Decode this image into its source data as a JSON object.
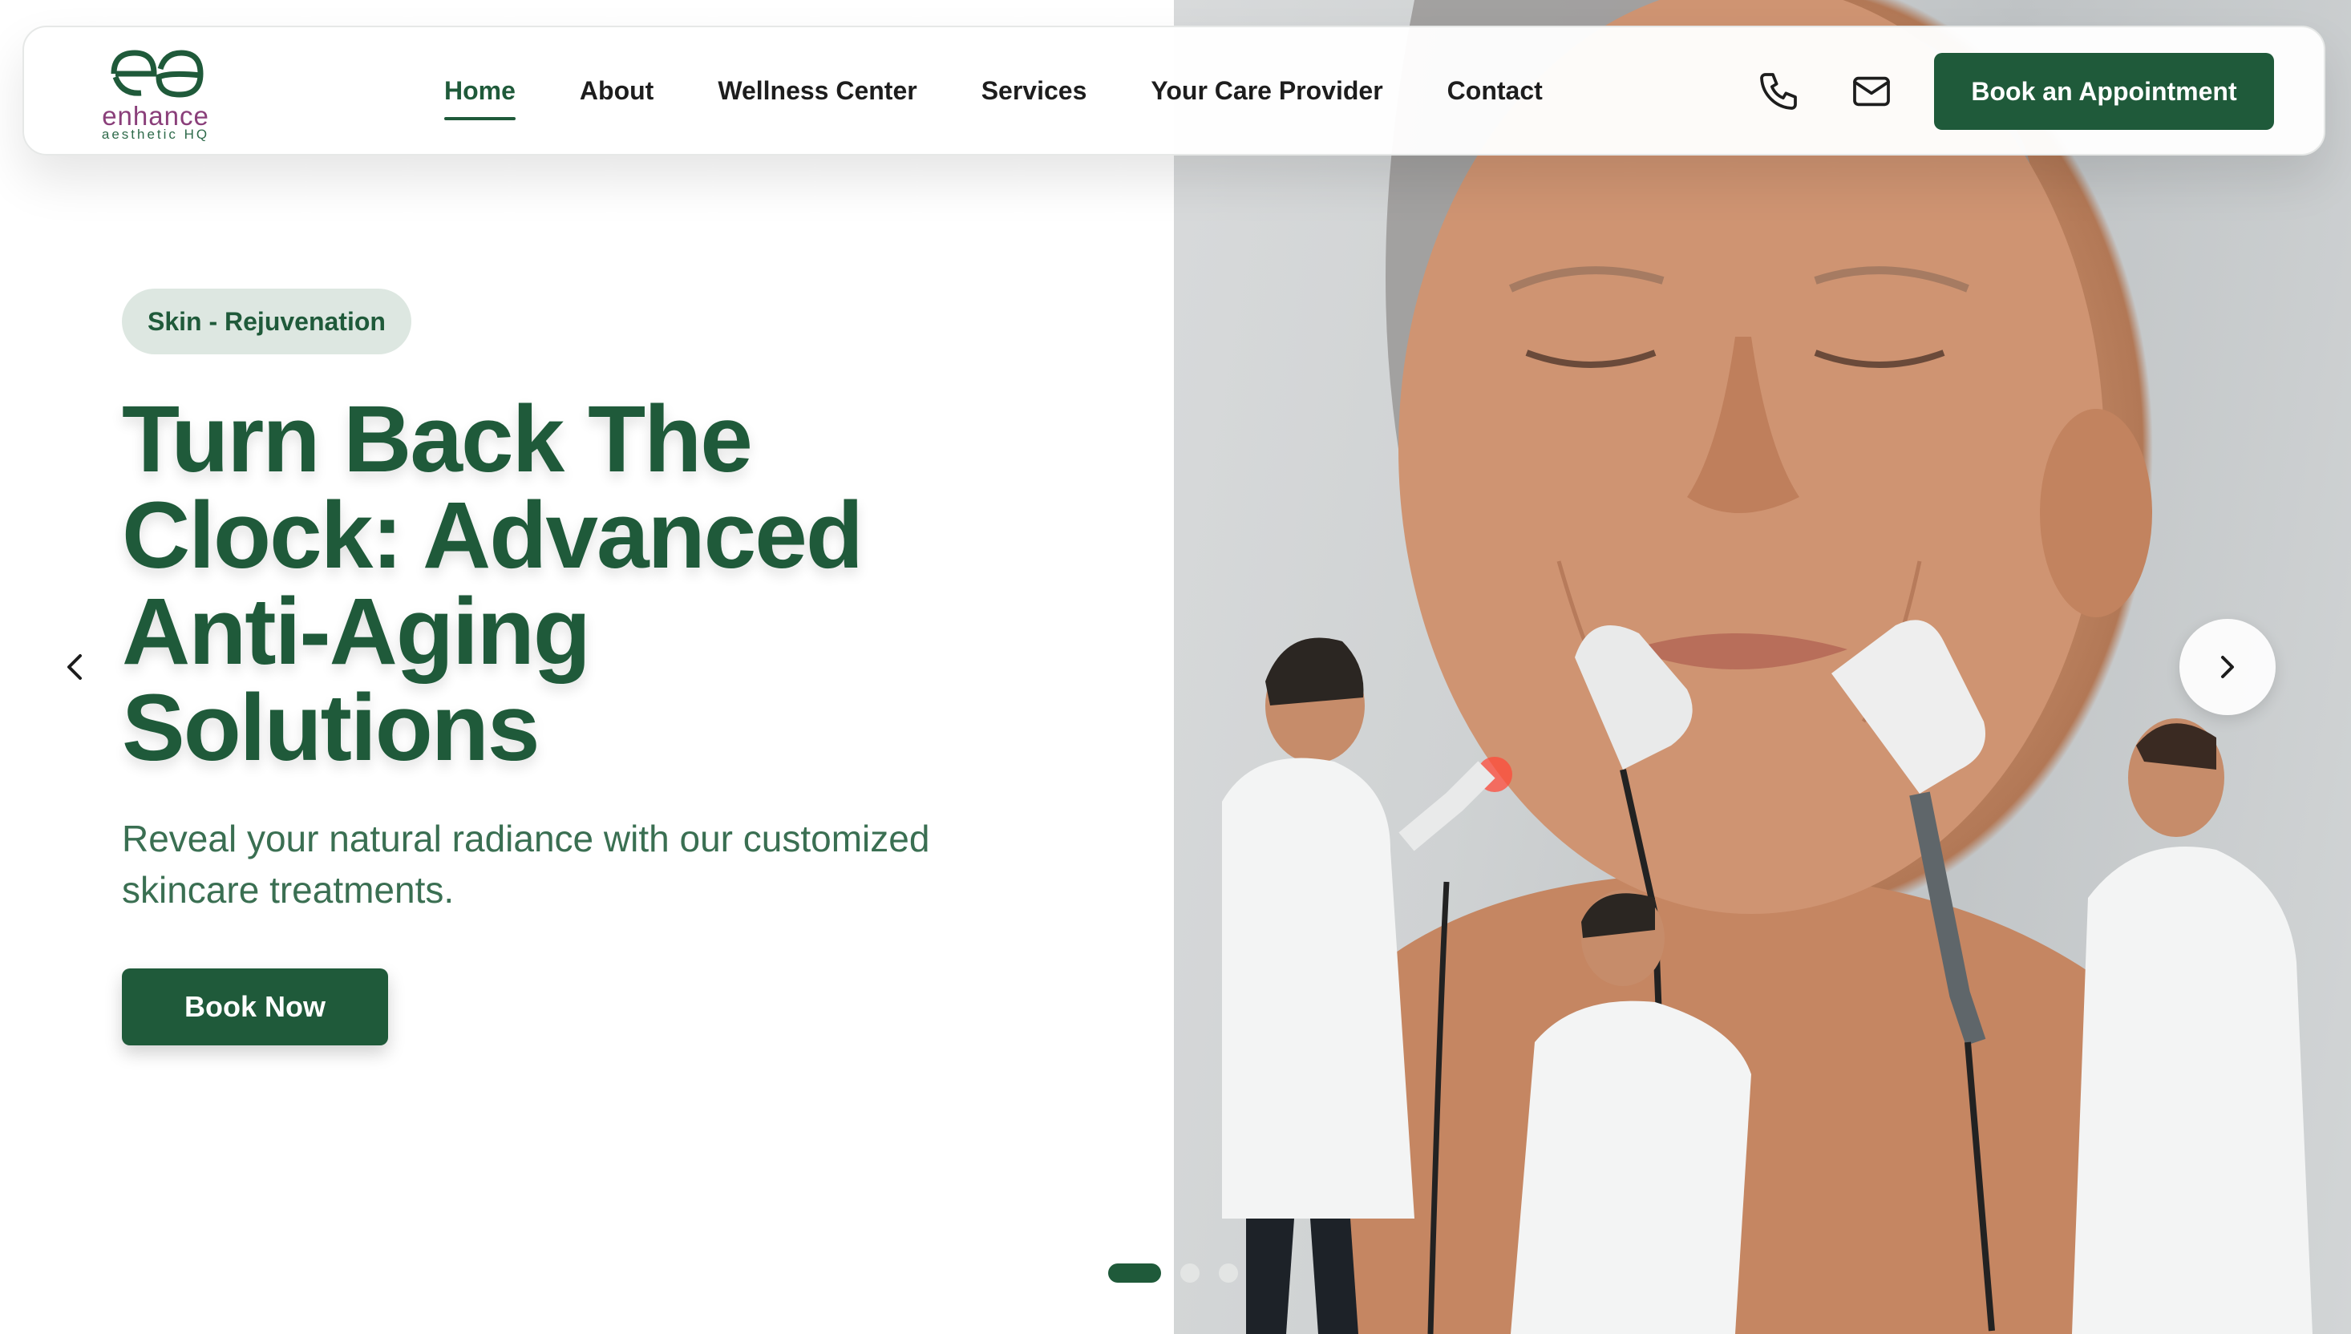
{
  "brand": {
    "name": "enhance",
    "subtitle": "aesthetic HQ"
  },
  "nav": {
    "items": [
      {
        "label": "Home",
        "active": true
      },
      {
        "label": "About",
        "active": false
      },
      {
        "label": "Wellness Center",
        "active": false
      },
      {
        "label": "Services",
        "active": false
      },
      {
        "label": "Your Care Provider",
        "active": false
      },
      {
        "label": "Contact",
        "active": false
      }
    ]
  },
  "header": {
    "phone_icon": "phone-icon",
    "mail_icon": "mail-icon",
    "cta_label": "Book an Appointment"
  },
  "hero": {
    "tag": "Skin - Rejuvenation",
    "headline_lines": [
      "Turn Back The",
      "Clock: Advanced",
      "Anti-Aging",
      "Solutions"
    ],
    "subtext": "Reveal your natural radiance with our customized skincare treatments.",
    "cta_label": "Book Now",
    "image_alt_icon": "hero-treatment-image"
  },
  "carousel": {
    "slide_count": 3,
    "active_index": 0,
    "prev_icon": "chevron-left-icon",
    "next_icon": "chevron-right-icon"
  },
  "colors": {
    "primary": "#1f5a3a",
    "tag_bg": "#dde7e1",
    "logo_accent": "#8a3f7a"
  }
}
